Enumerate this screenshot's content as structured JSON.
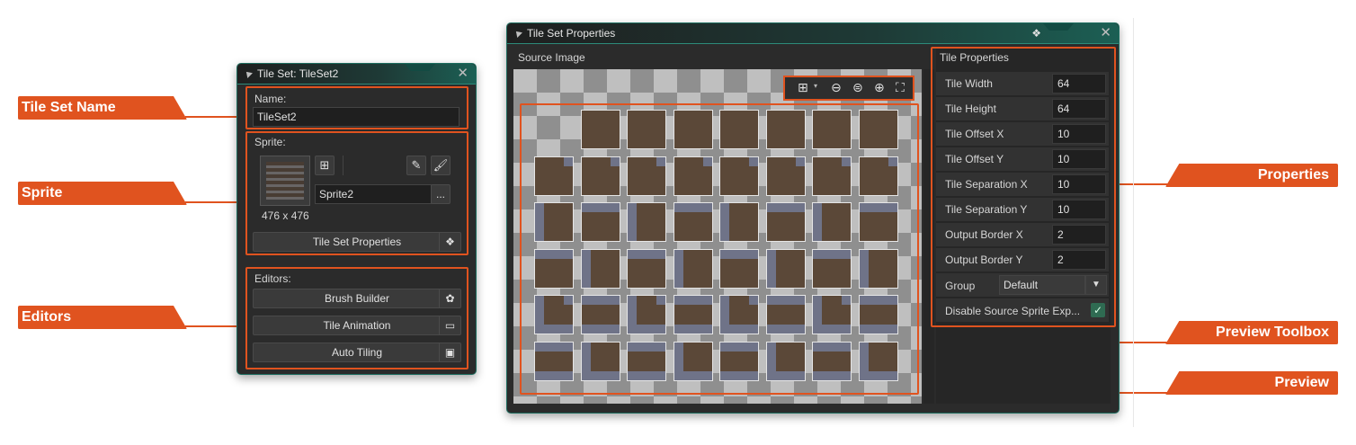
{
  "callouts": {
    "tile_set_name": "Tile Set Name",
    "sprite": "Sprite",
    "editors": "Editors",
    "properties": "Properties",
    "preview_toolbox": "Preview Toolbox",
    "preview": "Preview"
  },
  "tileset_window": {
    "title": "Tile Set: TileSet2",
    "name_label": "Name:",
    "name_value": "TileSet2",
    "sprite_label": "Sprite:",
    "sprite_name": "Sprite2",
    "sprite_browse": "...",
    "sprite_size": "476 x 476",
    "tileset_properties_button": "Tile Set Properties",
    "editors_label": "Editors:",
    "brush_builder_button": "Brush Builder",
    "tile_animation_button": "Tile Animation",
    "auto_tiling_button": "Auto Tiling"
  },
  "properties_window": {
    "title": "Tile Set Properties",
    "source_image_label": "Source Image",
    "tile_properties_label": "Tile Properties",
    "rows": [
      {
        "name": "Tile Width",
        "value": "64"
      },
      {
        "name": "Tile Height",
        "value": "64"
      },
      {
        "name": "Tile Offset X",
        "value": "10"
      },
      {
        "name": "Tile Offset Y",
        "value": "10"
      },
      {
        "name": "Tile Separation X",
        "value": "10"
      },
      {
        "name": "Tile Separation Y",
        "value": "10"
      },
      {
        "name": "Output Border X",
        "value": "2"
      },
      {
        "name": "Output Border Y",
        "value": "2"
      }
    ],
    "group_label": "Group",
    "group_value": "Default",
    "disable_label": "Disable Source Sprite Exp..."
  },
  "colors": {
    "accent": "#e0531f",
    "window_bg": "#2b2b2b",
    "title_teal": "#1c5f54"
  },
  "icons": [
    "grid-icon",
    "zoom-out-icon",
    "zoom-reset-icon",
    "zoom-in-icon",
    "fit-screen-icon",
    "close-icon",
    "brush-icon",
    "pencil-icon",
    "plus-sprite-icon",
    "flower-icon",
    "animation-icon",
    "lock-icon",
    "checkmark-icon",
    "dropdown-arrow-icon"
  ]
}
